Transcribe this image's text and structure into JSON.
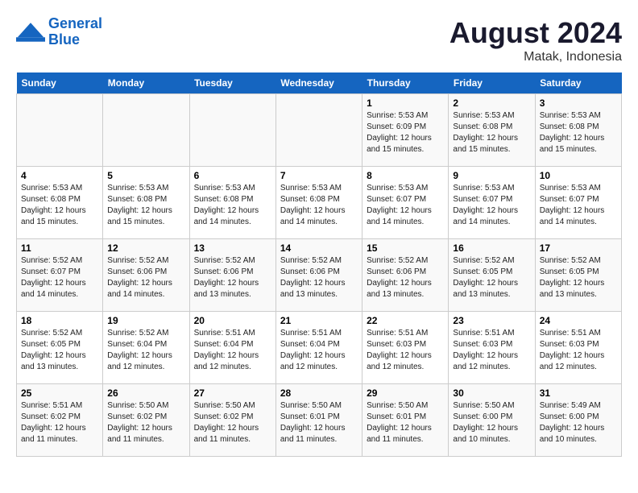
{
  "header": {
    "logo_line1": "General",
    "logo_line2": "Blue",
    "main_title": "August 2024",
    "sub_title": "Matak, Indonesia"
  },
  "calendar": {
    "days_of_week": [
      "Sunday",
      "Monday",
      "Tuesday",
      "Wednesday",
      "Thursday",
      "Friday",
      "Saturday"
    ],
    "weeks": [
      [
        {
          "day": "",
          "info": ""
        },
        {
          "day": "",
          "info": ""
        },
        {
          "day": "",
          "info": ""
        },
        {
          "day": "",
          "info": ""
        },
        {
          "day": "1",
          "info": "Sunrise: 5:53 AM\nSunset: 6:09 PM\nDaylight: 12 hours\nand 15 minutes."
        },
        {
          "day": "2",
          "info": "Sunrise: 5:53 AM\nSunset: 6:08 PM\nDaylight: 12 hours\nand 15 minutes."
        },
        {
          "day": "3",
          "info": "Sunrise: 5:53 AM\nSunset: 6:08 PM\nDaylight: 12 hours\nand 15 minutes."
        }
      ],
      [
        {
          "day": "4",
          "info": "Sunrise: 5:53 AM\nSunset: 6:08 PM\nDaylight: 12 hours\nand 15 minutes."
        },
        {
          "day": "5",
          "info": "Sunrise: 5:53 AM\nSunset: 6:08 PM\nDaylight: 12 hours\nand 15 minutes."
        },
        {
          "day": "6",
          "info": "Sunrise: 5:53 AM\nSunset: 6:08 PM\nDaylight: 12 hours\nand 14 minutes."
        },
        {
          "day": "7",
          "info": "Sunrise: 5:53 AM\nSunset: 6:08 PM\nDaylight: 12 hours\nand 14 minutes."
        },
        {
          "day": "8",
          "info": "Sunrise: 5:53 AM\nSunset: 6:07 PM\nDaylight: 12 hours\nand 14 minutes."
        },
        {
          "day": "9",
          "info": "Sunrise: 5:53 AM\nSunset: 6:07 PM\nDaylight: 12 hours\nand 14 minutes."
        },
        {
          "day": "10",
          "info": "Sunrise: 5:53 AM\nSunset: 6:07 PM\nDaylight: 12 hours\nand 14 minutes."
        }
      ],
      [
        {
          "day": "11",
          "info": "Sunrise: 5:52 AM\nSunset: 6:07 PM\nDaylight: 12 hours\nand 14 minutes."
        },
        {
          "day": "12",
          "info": "Sunrise: 5:52 AM\nSunset: 6:06 PM\nDaylight: 12 hours\nand 14 minutes."
        },
        {
          "day": "13",
          "info": "Sunrise: 5:52 AM\nSunset: 6:06 PM\nDaylight: 12 hours\nand 13 minutes."
        },
        {
          "day": "14",
          "info": "Sunrise: 5:52 AM\nSunset: 6:06 PM\nDaylight: 12 hours\nand 13 minutes."
        },
        {
          "day": "15",
          "info": "Sunrise: 5:52 AM\nSunset: 6:06 PM\nDaylight: 12 hours\nand 13 minutes."
        },
        {
          "day": "16",
          "info": "Sunrise: 5:52 AM\nSunset: 6:05 PM\nDaylight: 12 hours\nand 13 minutes."
        },
        {
          "day": "17",
          "info": "Sunrise: 5:52 AM\nSunset: 6:05 PM\nDaylight: 12 hours\nand 13 minutes."
        }
      ],
      [
        {
          "day": "18",
          "info": "Sunrise: 5:52 AM\nSunset: 6:05 PM\nDaylight: 12 hours\nand 13 minutes."
        },
        {
          "day": "19",
          "info": "Sunrise: 5:52 AM\nSunset: 6:04 PM\nDaylight: 12 hours\nand 12 minutes."
        },
        {
          "day": "20",
          "info": "Sunrise: 5:51 AM\nSunset: 6:04 PM\nDaylight: 12 hours\nand 12 minutes."
        },
        {
          "day": "21",
          "info": "Sunrise: 5:51 AM\nSunset: 6:04 PM\nDaylight: 12 hours\nand 12 minutes."
        },
        {
          "day": "22",
          "info": "Sunrise: 5:51 AM\nSunset: 6:03 PM\nDaylight: 12 hours\nand 12 minutes."
        },
        {
          "day": "23",
          "info": "Sunrise: 5:51 AM\nSunset: 6:03 PM\nDaylight: 12 hours\nand 12 minutes."
        },
        {
          "day": "24",
          "info": "Sunrise: 5:51 AM\nSunset: 6:03 PM\nDaylight: 12 hours\nand 12 minutes."
        }
      ],
      [
        {
          "day": "25",
          "info": "Sunrise: 5:51 AM\nSunset: 6:02 PM\nDaylight: 12 hours\nand 11 minutes."
        },
        {
          "day": "26",
          "info": "Sunrise: 5:50 AM\nSunset: 6:02 PM\nDaylight: 12 hours\nand 11 minutes."
        },
        {
          "day": "27",
          "info": "Sunrise: 5:50 AM\nSunset: 6:02 PM\nDaylight: 12 hours\nand 11 minutes."
        },
        {
          "day": "28",
          "info": "Sunrise: 5:50 AM\nSunset: 6:01 PM\nDaylight: 12 hours\nand 11 minutes."
        },
        {
          "day": "29",
          "info": "Sunrise: 5:50 AM\nSunset: 6:01 PM\nDaylight: 12 hours\nand 11 minutes."
        },
        {
          "day": "30",
          "info": "Sunrise: 5:50 AM\nSunset: 6:00 PM\nDaylight: 12 hours\nand 10 minutes."
        },
        {
          "day": "31",
          "info": "Sunrise: 5:49 AM\nSunset: 6:00 PM\nDaylight: 12 hours\nand 10 minutes."
        }
      ]
    ]
  }
}
